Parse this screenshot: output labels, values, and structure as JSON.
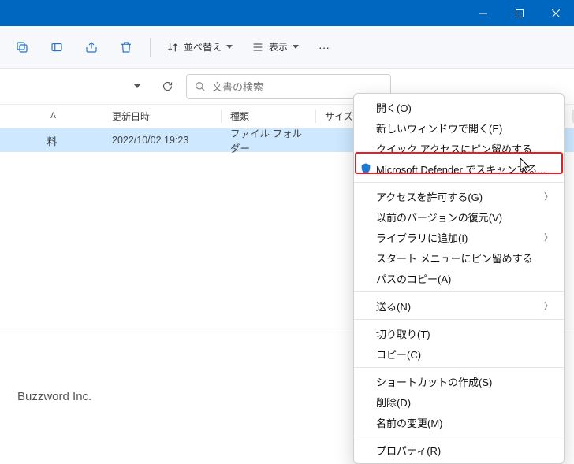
{
  "window": {
    "title": ""
  },
  "toolbar": {
    "sort_label": "並べ替え",
    "view_label": "表示"
  },
  "search": {
    "placeholder": "文書の検索"
  },
  "headers": {
    "name": "",
    "date": "更新日時",
    "type": "種類",
    "size": "サイズ"
  },
  "row": {
    "name": "料",
    "date": "2022/10/02 19:23",
    "type": "ファイル フォルダー",
    "size": ""
  },
  "footer": {
    "brand": "Buzzword Inc."
  },
  "context_menu": {
    "open": "開く(O)",
    "open_new_window": "新しいウィンドウで開く(E)",
    "pin_quick": "クイック アクセスにピン留めする",
    "defender": "Microsoft Defender でスキャンする...",
    "grant_access": "アクセスを許可する(G)",
    "restore_versions": "以前のバージョンの復元(V)",
    "add_library": "ライブラリに追加(I)",
    "pin_start": "スタート メニューにピン留めする",
    "copy_path": "パスのコピー(A)",
    "send_to": "送る(N)",
    "cut": "切り取り(T)",
    "copy": "コピー(C)",
    "create_shortcut": "ショートカットの作成(S)",
    "delete": "削除(D)",
    "rename": "名前の変更(M)",
    "properties": "プロパティ(R)"
  }
}
